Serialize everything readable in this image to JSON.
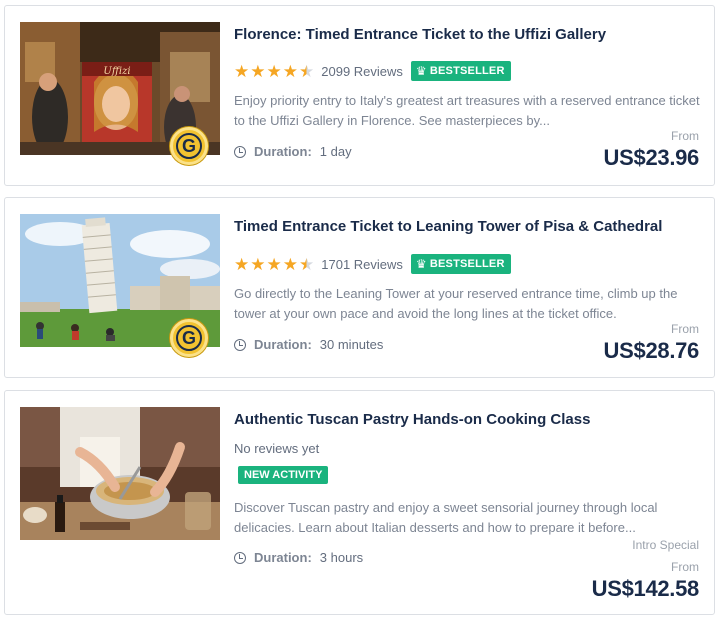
{
  "cards": [
    {
      "title": "Florence: Timed Entrance Ticket to the Uffizi Gallery",
      "rating": 4.5,
      "reviews": "2099 Reviews",
      "badge": "BESTSELLER",
      "description": "Enjoy priority entry to Italy's greatest art treasures with a reserved entrance ticket to the Uffizi Gallery in Florence. See masterpieces by...",
      "duration_label": "Duration:",
      "duration_value": "1 day",
      "from_label": "From",
      "price": "US$23.96",
      "image_icon": "uffizi-gallery-shop-photo",
      "image_text": "Uffizi",
      "g_badge": "G"
    },
    {
      "title": "Timed Entrance Ticket to Leaning Tower of Pisa & Cathedral",
      "rating": 4.5,
      "reviews": "1701 Reviews",
      "badge": "BESTSELLER",
      "description": "Go directly to the Leaning Tower at your reserved entrance time, climb up the tower at your own pace and avoid the long lines at the ticket office.",
      "duration_label": "Duration:",
      "duration_value": "30 minutes",
      "from_label": "From",
      "price": "US$28.76",
      "image_icon": "leaning-tower-pisa-photo",
      "g_badge": "G"
    },
    {
      "title": "Authentic Tuscan Pastry Hands-on Cooking Class",
      "no_reviews": "No reviews yet",
      "badge": "NEW ACTIVITY",
      "description": "Discover Tuscan pastry and enjoy a sweet sensorial journey through local delicacies. Learn about Italian desserts and how to prepare it before...",
      "duration_label": "Duration:",
      "duration_value": "3 hours",
      "intro_label": "Intro Special",
      "from_label": "From",
      "price": "US$142.58",
      "image_icon": "pastry-cooking-class-photo"
    }
  ],
  "colors": {
    "title": "#1a2b49",
    "star": "#f5a623",
    "badge_green": "#1ab37e",
    "muted_text": "#7d8593",
    "border": "#dcdfe4"
  }
}
